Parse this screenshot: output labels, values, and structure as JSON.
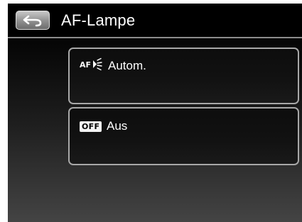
{
  "header": {
    "title": "AF-Lampe",
    "back_icon": "back-arrow-icon"
  },
  "options": [
    {
      "label": "Autom.",
      "icon": "af-assist-lamp-icon"
    },
    {
      "label": "Aus",
      "icon": "off-icon",
      "icon_text": "OFF"
    }
  ]
}
